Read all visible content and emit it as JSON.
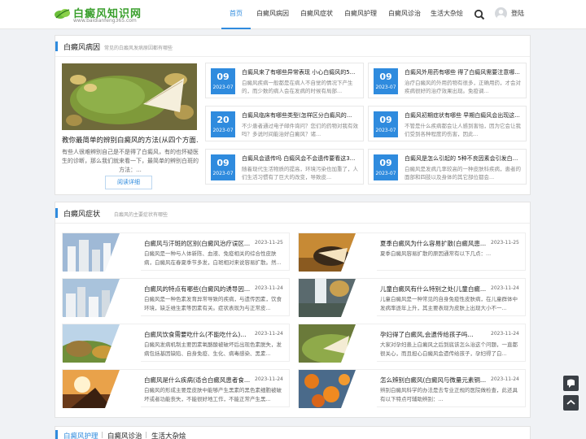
{
  "site": {
    "logo_title": "白癜风知识网",
    "logo_sub": "www.baidianfeng365.com"
  },
  "nav": {
    "items": [
      "首页",
      "白癜风病因",
      "白癜风症状",
      "白癜风护理",
      "白癜风诊治",
      "生活大杂烩"
    ],
    "active_index": 0,
    "login": "登陆"
  },
  "section1": {
    "title": "白癜风病因",
    "subtitle": "常见的白癜风发病原因都有哪些",
    "featured": {
      "title": "教你最简单的辨别白癜风的方法(从四个方面…",
      "desc": "有些人很难辨别自己是不是得了白癜风，有的也怀疑医生的诊断，那么我们就来看一下，最简单的辨别白斑的方法：...",
      "button": "阅读详细"
    },
    "cards": [
      {
        "day": "09",
        "ym": "2023-07",
        "title": "白癜风来了有哪些异常表现 小心白癜风的5...",
        "desc": "白癜风疾病一般都是在病人不自觉的情况下产生的，而少数的病人会在发病的时候有局部..."
      },
      {
        "day": "09",
        "ym": "2023-07",
        "title": "白癜风外用药有哪些 得了白癜风需要注意哪...",
        "desc": "治疗白癜风的外用药物有很多，正确用药，才会对疾病很好的治疗效果出现。免疫调..."
      },
      {
        "day": "20",
        "ym": "2023-07",
        "title": "白癜风临床有哪些类型(怎样区分白癜风的...",
        "desc": "不少患者通过电子邮件询问？您们的药物对我有效吗？多说时间能治好白癜风？诸..."
      },
      {
        "day": "09",
        "ym": "2023-07",
        "title": "白癜风初期症状有哪些 早期白癜风会出现这...",
        "desc": "不管是什么疾病都会让人感到害怕，因为它会让我们受到各种程度的伤害，因此..."
      },
      {
        "day": "09",
        "ym": "2023-07",
        "title": "白癜风会遗传吗 白癜风会不会遗传要看这3...",
        "desc": "随着现代生活物质的提高，环境污染也加重了，人们生活习惯有了巨大的改变，导致皮..."
      },
      {
        "day": "09",
        "ym": "2023-07",
        "title": "白癜风是怎么引起的 5种不良因素会引发白...",
        "desc": "白癜风是发病几率较高的一种皮肤科疾病，患者的面部和四肢以及身体的其它部位都会..."
      }
    ]
  },
  "section2": {
    "title": "白癜风症状",
    "subtitle": "白癜风的主要症状有哪些",
    "items": [
      {
        "title": "白癜风与汗斑的区别(白癜风治疗误区...",
        "date": "2023-11-25",
        "desc": "白癜风是一种与人体新陈、血液、免疫相关的综合性皮肤病，白癜风在春夏季节多发，白斑相对来说容易扩散。然..."
      },
      {
        "title": "夏季白癜风为什么容易扩散(白癜风患...",
        "date": "2023-11-25",
        "desc": "夏季白癜风容易扩散的原因通常有以下几点：..."
      },
      {
        "title": "白癜风的特点有哪些(白癜风的诱导因...",
        "date": "2023-11-24",
        "desc": "白癜风是一种色素发育异常导致的疾病，与遗传因素，饮食环境，缺乏维生素等因素有关。症状表现为与正常皮..."
      },
      {
        "title": "儿童白癜风有什么特别之处(儿童白癜...",
        "date": "2023-11-24",
        "desc": "儿童白癜风是一种常见的自身免疫性皮肤病，在儿童群体中发病率逐年上升，其主要表现为皮肤上出现大小不一..."
      },
      {
        "title": "白癜风饮食需要吃什么(不能吃什么)...",
        "date": "2023-11-24",
        "desc": "白癜风发病机制主要因素氧酪酸被破坏后出现色素脱失，发病包括基因缺陷、自身免疫、生化、病毒感染、黑素..."
      },
      {
        "title": "孕妇得了白癜风,会遗传给孩子吗...",
        "date": "2023-11-24",
        "desc": "大家对孕妇患上白癜风之后到底该怎么治这个问题，一直都很关心，而且担心白癜风会遗传给孩子，孕妇得了白..."
      },
      {
        "title": "白癜风是什么疾病(适合白癜风患者食...",
        "date": "2023-11-24",
        "desc": "白癜风的形成主要是皮肤中能够产生黑素的黑色素细胞被破坏或者功能丧失，不能很好地工作，不能正常产生黑..."
      },
      {
        "title": "怎么辨别白癜风(白癜风与微量元素铜...",
        "date": "2023-11-24",
        "desc": "辨别白癜风科学的办法是去专业正规的医院做检查，此还具有以下特点可辅助辨别：..."
      }
    ]
  },
  "section3": {
    "tabs": [
      "白癜风护理",
      "白癜风诊治",
      "生活大杂烩"
    ],
    "separator": "|"
  },
  "colors": {
    "accent": "#2f8bde",
    "logo_green": "#3a9f2d",
    "float_bg": "#3a3f45"
  },
  "icons": [
    "logo-leaf-icon",
    "search-icon",
    "user-avatar-icon",
    "chat-icon",
    "back-to-top-icon"
  ]
}
